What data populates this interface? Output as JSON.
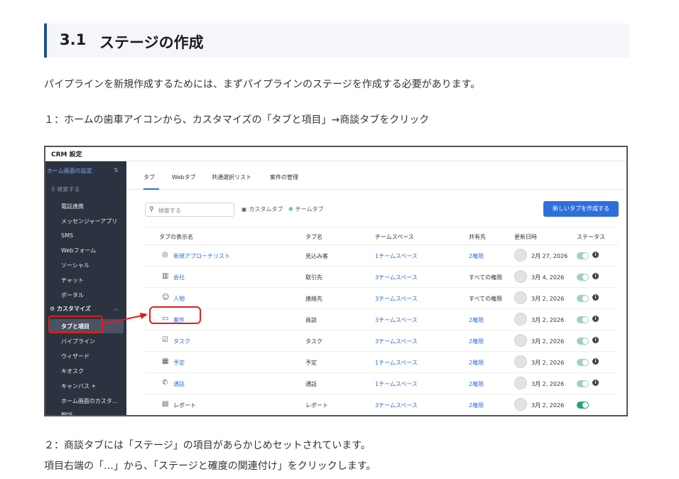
{
  "section": {
    "number": "3.1",
    "title": "ステージの作成"
  },
  "paragraphs": {
    "intro": "パイプラインを新規作成するためには、まずパイプラインのステージを作成する必要があります。",
    "step1": "１：ホームの歯車アイコンから、カスタマイズの「タブと項目」→商談タブをクリック",
    "step2": "２：商談タブには「ステージ」の項目があらかじめセットされています。",
    "step2b": "項目右端の「…」から、「ステージと確度の関連付け」をクリックします。"
  },
  "screenshot": {
    "window_title": "CRM 設定",
    "sidebar": {
      "header": "ホーム画面の設定",
      "search_placeholder": "検索する",
      "items_top": [
        "電話連携",
        "メッセンジャーアプリ",
        "SMS",
        "Webフォーム",
        "ソーシャル",
        "チャット",
        "ポータル"
      ],
      "section_label": "カスタマイズ",
      "items_custom": [
        "タブと項目",
        "パイプライン",
        "ウィザード",
        "キオスク",
        "キャンバス",
        "ホーム画面のカスタ...",
        "翻訳"
      ]
    },
    "tabs": [
      "タブ",
      "Webタブ",
      "共通選択リスト",
      "案件の管理"
    ],
    "search_placeholder": "検索する",
    "custom_tab_label": "カスタムタブ",
    "team_tab_label": "チームタブ",
    "new_tab_button": "新しいタブを作成する",
    "columns": [
      "タブの表示名",
      "タブ名",
      "チームスペース",
      "共有先",
      "更新日時",
      "ステータス"
    ],
    "rows": [
      {
        "icon": "target-icon",
        "display": "新規アプローチリスト",
        "name": "見込み客",
        "space": "1チームスペース",
        "share": "2権限",
        "date": "2月 27, 2026",
        "status": "on"
      },
      {
        "icon": "building-icon",
        "display": "会社",
        "name": "取引先",
        "space": "3チームスペース",
        "share": "すべての権限",
        "date": "3月 4, 2026",
        "status": "on"
      },
      {
        "icon": "person-icon",
        "display": "人物",
        "name": "連絡先",
        "space": "3チームスペース",
        "share": "すべての権限",
        "date": "3月 2, 2026",
        "status": "on"
      },
      {
        "icon": "briefcase-icon",
        "display": "案件",
        "name": "商談",
        "space": "3チームスペース",
        "share": "2権限",
        "date": "3月 2, 2026",
        "status": "on"
      },
      {
        "icon": "checkbox-icon",
        "display": "タスク",
        "name": "タスク",
        "space": "3チームスペース",
        "share": "2権限",
        "date": "3月 2, 2026",
        "status": "on"
      },
      {
        "icon": "calendar-icon",
        "display": "予定",
        "name": "予定",
        "space": "1チームスペース",
        "share": "2権限",
        "date": "3月 2, 2026",
        "status": "on"
      },
      {
        "icon": "phone-icon",
        "display": "通話",
        "name": "通話",
        "space": "1チームスペース",
        "share": "2権限",
        "date": "3月 2, 2026",
        "status": "on"
      },
      {
        "icon": "report-icon",
        "display": "レポート",
        "name": "レポート",
        "space": "3チームスペース",
        "share": "2権限",
        "date": "3月 2, 2026",
        "status": "active"
      }
    ],
    "colors": {
      "accent": "#2f6fdb",
      "sidebar": "#2c3340",
      "annotation": "#e21d1d",
      "toggle": "#2aa36b"
    }
  }
}
